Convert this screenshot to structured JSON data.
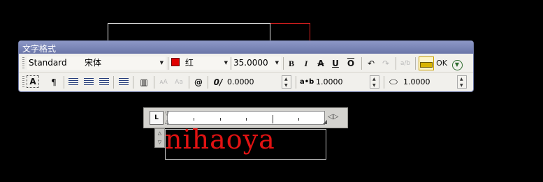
{
  "toolbar": {
    "title": "文字格式",
    "style_value": "Standard",
    "font_value": "宋体",
    "color_value": "红",
    "color_swatch": "#e00000",
    "height_value": "35.0000",
    "bold_glyph": "B",
    "italic_glyph": "I",
    "strike_glyph": "A",
    "underline_glyph": "U",
    "overline_glyph": "O",
    "ok_label": "OK",
    "oblique_value": "0.0000",
    "tracking_label": "a•b",
    "tracking_value": "1.0000",
    "width_value": "1.0000"
  },
  "editor": {
    "text": "nihaoya",
    "ruler_tab_label": "L",
    "text_color": "#e21212"
  }
}
